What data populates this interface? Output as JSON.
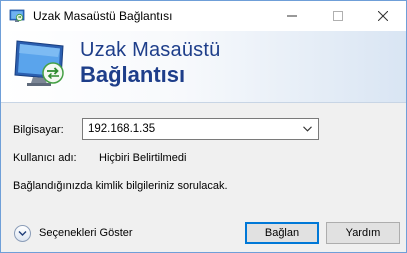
{
  "window": {
    "title": "Uzak Masaüstü Bağlantısı",
    "buttons": {
      "minimize": "minimize",
      "maximize": "maximize",
      "close": "close"
    }
  },
  "banner": {
    "line1": "Uzak Masaüstü",
    "line2": "Bağlantısı"
  },
  "form": {
    "computer_label": "Bilgisayar:",
    "computer_value": "192.168.1.35",
    "user_label": "Kullanıcı adı:",
    "user_value": "Hiçbiri Belirtilmedi",
    "info_text": "Bağlandığınızda kimlik bilgileriniz sorulacak."
  },
  "footer": {
    "options_label": "Seçenekleri Göster",
    "connect_label": "Bağlan",
    "help_label": "Yardım"
  },
  "colors": {
    "banner_text": "#1e3e8a",
    "focus_border": "#0078d7"
  }
}
